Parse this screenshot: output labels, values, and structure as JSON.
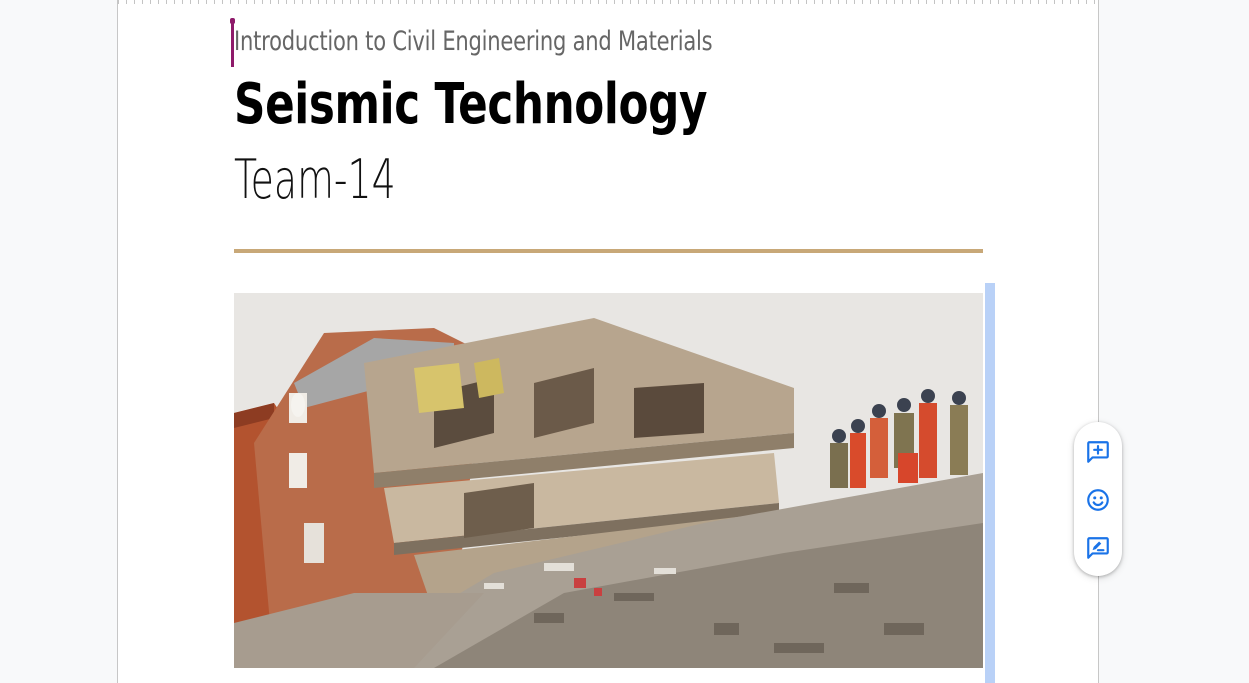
{
  "document": {
    "subtitle": "Introduction to Civil Engineering and Materials",
    "title": "Seismic Technology",
    "team": "Team-14"
  },
  "image": {
    "name": "earthquake-collapsed-building-photo"
  },
  "floating_toolbar": {
    "items": [
      {
        "icon": "add-comment-icon"
      },
      {
        "icon": "emoji-reaction-icon"
      },
      {
        "icon": "suggest-edits-icon"
      }
    ]
  },
  "colors": {
    "accent_rule": "#c8a878",
    "cursor": "#8e1a6a",
    "toolbar_icon": "#1a73e8",
    "selection": "#b9d1f7"
  }
}
